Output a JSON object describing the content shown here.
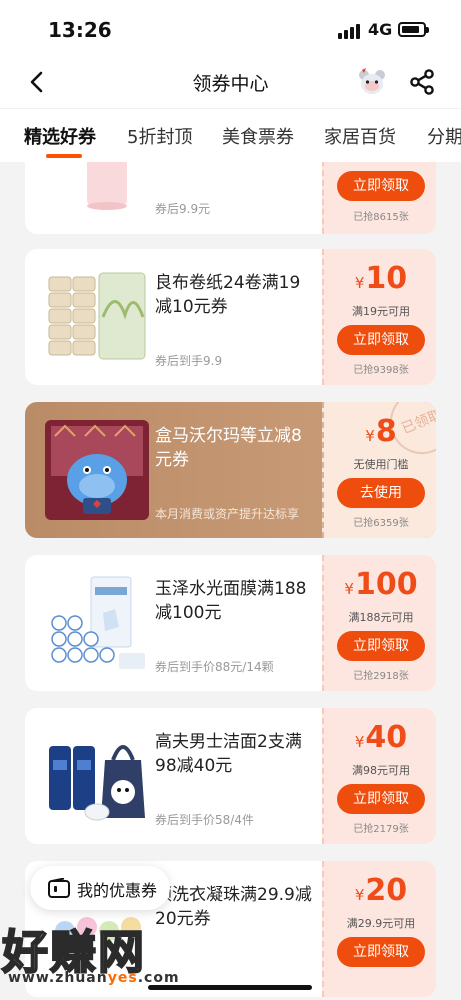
{
  "status": {
    "time": "13:26",
    "network": "4G",
    "battery_level": 0.7
  },
  "nav": {
    "title": "领券中心",
    "icons": [
      "back-icon",
      "mascot-icon",
      "share-icon"
    ]
  },
  "tabs": [
    {
      "label": "精选好券",
      "active": true
    },
    {
      "label": "5折封顶",
      "active": false
    },
    {
      "label": "美食票券",
      "active": false
    },
    {
      "label": "家居百货",
      "active": false
    },
    {
      "label": "分期",
      "active": false
    }
  ],
  "coupons": [
    {
      "title": "",
      "subtitle": "券后9.9元",
      "price": "",
      "condition": "",
      "button": "立即领取",
      "grabbed": "已抢8615张"
    },
    {
      "title": "良布卷纸24卷满19减10元券",
      "subtitle": "券后到手9.9",
      "currency": "¥",
      "price": "10",
      "condition": "满19元可用",
      "button": "立即领取",
      "grabbed": "已抢9398张"
    },
    {
      "title": "盒马沃尔玛等立减8元券",
      "subtitle": "本月消费或资产提升达标享",
      "currency": "¥",
      "price": "8",
      "condition": "无使用门槛",
      "button": "去使用",
      "grabbed": "已抢6359张",
      "stamp": "已领取"
    },
    {
      "title": "玉泽水光面膜满188减100元",
      "subtitle": "券后到手价88元/14颗",
      "currency": "¥",
      "price": "100",
      "condition": "满188元可用",
      "button": "立即领取",
      "grabbed": "已抢2918张"
    },
    {
      "title": "高夫男士洁面2支满98减40元",
      "subtitle": "券后到手价58/4件",
      "currency": "¥",
      "price": "40",
      "condition": "满98元可用",
      "button": "立即领取",
      "grabbed": "已抢2179张"
    },
    {
      "title": "颜洗衣凝珠满29.9减20元券",
      "subtitle": "",
      "currency": "¥",
      "price": "20",
      "condition": "满29.9元可用",
      "button": "立即领取",
      "grabbed": ""
    }
  ],
  "floating": {
    "my_coupons": "我的优惠券"
  },
  "watermark": {
    "main": "好赚网",
    "url_prefix": "www.zhuan",
    "url_highlight": "yes",
    "url_suffix": ".com"
  },
  "colors": {
    "accent": "#ee4d0d",
    "price": "#ee4d1a",
    "coupon_bg": "#fde6df",
    "special_bg": "#c39673"
  }
}
